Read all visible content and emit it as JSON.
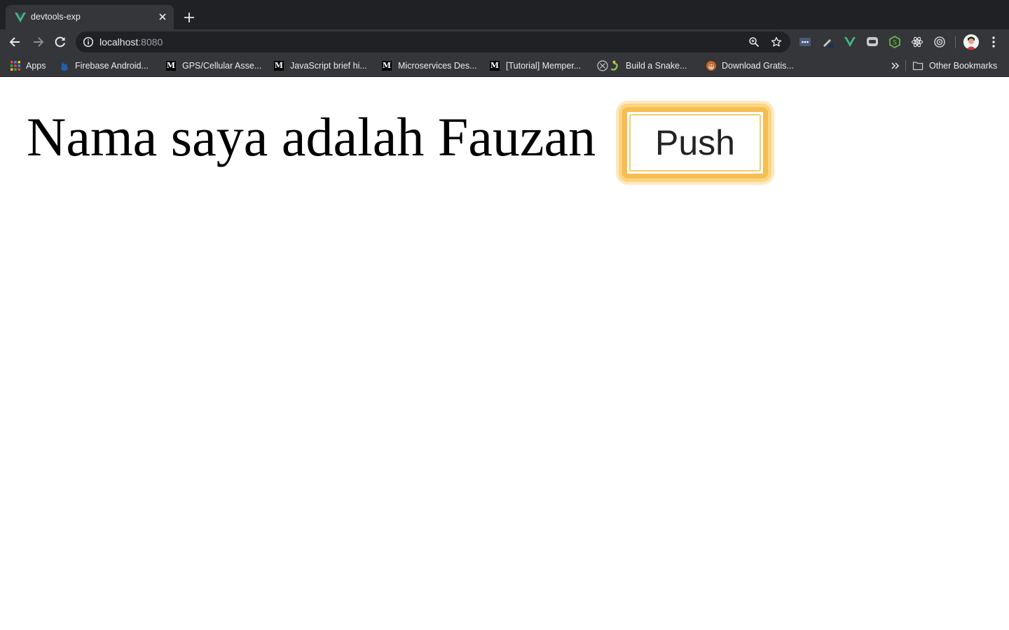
{
  "browser": {
    "tab": {
      "title": "devtools-exp"
    },
    "address": {
      "host": "localhost",
      "port": ":8080"
    },
    "extension_icons": [
      "dots-extension-icon",
      "pen-extension-icon",
      "vue-devtools-icon",
      "chat-extension-icon",
      "node-extension-icon",
      "react-devtools-icon",
      "target-extension-icon"
    ],
    "bookmarks": [
      {
        "label": "Apps",
        "icon": "apps-grid-icon"
      },
      {
        "label": "Firebase Android...",
        "icon": "firebase-icon"
      },
      {
        "label": "GPS/Cellular Asse...",
        "icon": "medium-icon"
      },
      {
        "label": "JavaScript brief hi...",
        "icon": "medium-icon"
      },
      {
        "label": "Microservices Des...",
        "icon": "medium-icon"
      },
      {
        "label": "[Tutorial] Memper...",
        "icon": "medium-icon"
      },
      {
        "label": "Build a Snake...",
        "icon": "snake-icon"
      },
      {
        "label": "Download Gratis...",
        "icon": "monkey-icon"
      }
    ],
    "other_bookmarks": "Other Bookmarks"
  },
  "page": {
    "heading": "Nama saya adalah Fauzan",
    "button_label": "Push"
  },
  "colors": {
    "tabstrip": "#202124",
    "toolbar": "#35363a",
    "focus_ring": "#f6bd51",
    "vue_green": "#41b883"
  }
}
